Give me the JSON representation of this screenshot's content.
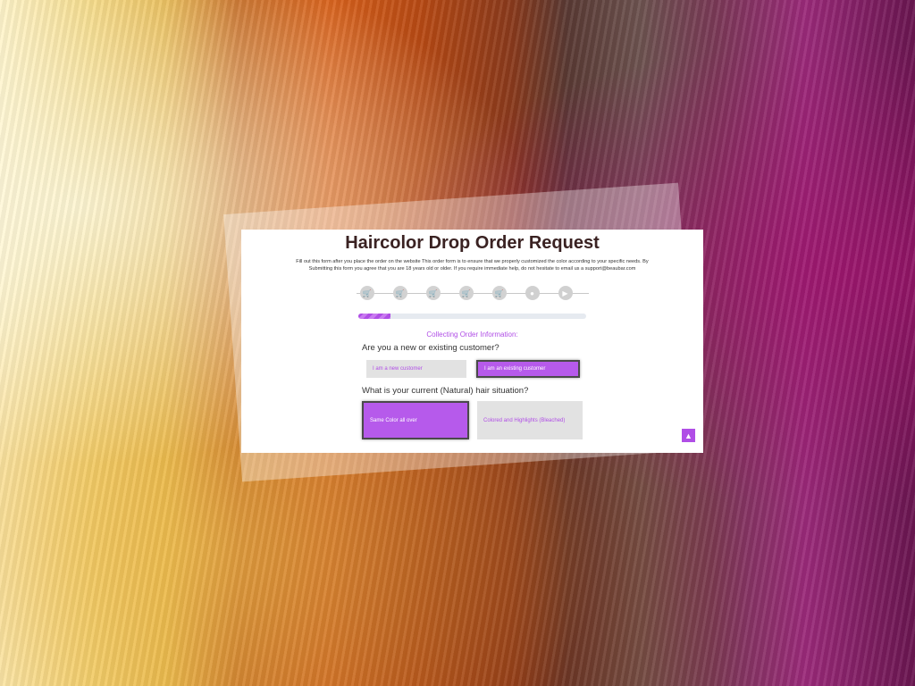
{
  "form": {
    "title": "Haircolor Drop Order Request",
    "intro": "Fill out this form after you place the order on the website This order form is to ensure that we properly customized the color according to your specific needs. By Submitting this form you agree that you are 18 years old or older. If you require immediate help, do not hesitate to email us a support@beaubar.com",
    "steps": [
      {
        "icon": "cart-icon",
        "glyph": "🛒"
      },
      {
        "icon": "cart-icon",
        "glyph": "🛒"
      },
      {
        "icon": "cart-icon",
        "glyph": "🛒"
      },
      {
        "icon": "cart-icon",
        "glyph": "🛒"
      },
      {
        "icon": "cart-icon",
        "glyph": "🛒"
      },
      {
        "icon": "info-icon",
        "glyph": "●"
      },
      {
        "icon": "play-icon",
        "glyph": "▶"
      }
    ],
    "progress_fraction": 0.14,
    "status_text": "Collecting Order Information:",
    "q1": {
      "label": "Are you a new or existing customer?",
      "options": [
        "I am a new customer",
        "I am an existing customer"
      ],
      "selected": "I am an existing customer"
    },
    "q2": {
      "label": "What is your current (Natural) hair situation?",
      "options": [
        "Same Color all over",
        "Colored and Highlights (Bleached)"
      ],
      "selected": "Same Color all over"
    },
    "scroll_top_icon": "chevrons-up-icon"
  },
  "colors": {
    "accent": "#b04ee6",
    "selected_bg": "#b65aeb",
    "unselected_bg": "#e2e2e2"
  }
}
